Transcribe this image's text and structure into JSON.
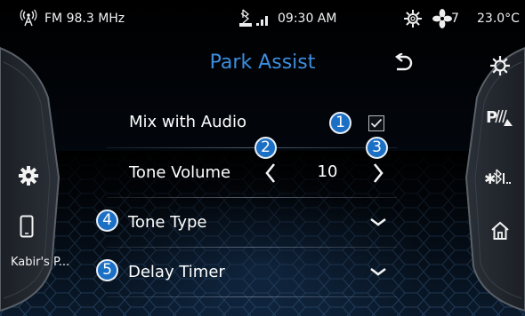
{
  "status_bar": {
    "radio_icon": "radio-antenna-icon",
    "radio_station": "FM 98.3 MHz",
    "bluetooth_icon": "bluetooth-phone-icon",
    "signal_icon": "signal-bars-icon",
    "time": "09:30 AM",
    "ac_icon": "gear-icon",
    "fan_icon": "fan-icon",
    "fan_level": "7",
    "temperature": "23.0°C"
  },
  "left_panel": {
    "settings_icon": "gear-icon",
    "phone_icon": "phone-icon",
    "device_name": "Kabir's P..."
  },
  "right_panel": {
    "items": [
      "gear-icon",
      "park-assist-icon",
      "bluetooth-settings-icon",
      "home-icon"
    ]
  },
  "header": {
    "title": "Park Assist",
    "back_icon": "back-arrow-icon"
  },
  "settings": {
    "mix_audio": {
      "label": "Mix with Audio",
      "checked": true,
      "badge": "1"
    },
    "tone_volume": {
      "label": "Tone Volume",
      "value": "10",
      "decrease_badge": "2",
      "increase_badge": "3"
    },
    "tone_type": {
      "label": "Tone Type",
      "badge": "4"
    },
    "delay_timer": {
      "label": "Delay Timer",
      "badge": "5"
    }
  },
  "colors": {
    "accent": "#3d8ede",
    "badge": "#1b6fc4",
    "background": "#000000"
  }
}
